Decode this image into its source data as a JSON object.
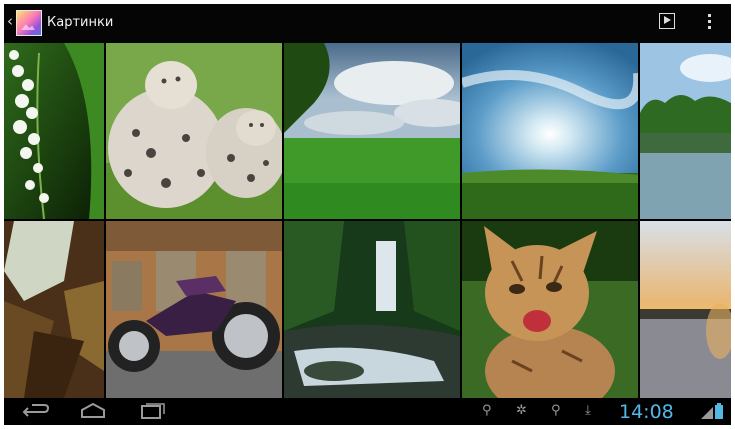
{
  "action_bar": {
    "title": "Картинки",
    "app_icon": "gallery-app-icon",
    "back_icon": "chevron-left-icon",
    "actions": [
      "slideshow-icon",
      "overflow-menu-icon"
    ]
  },
  "grid": {
    "photos": [
      {
        "subject": "lily-of-the-valley"
      },
      {
        "subject": "snow-leopards"
      },
      {
        "subject": "green-meadow-sky"
      },
      {
        "subject": "sunset-grass-field"
      },
      {
        "subject": "lake-trees-reflection"
      },
      {
        "subject": "autumn-leaves"
      },
      {
        "subject": "motorcycle"
      },
      {
        "subject": "forest-waterfall"
      },
      {
        "subject": "kitten"
      },
      {
        "subject": "lake-sunset"
      }
    ]
  },
  "nav_bar": {
    "buttons": [
      "back-icon",
      "home-icon",
      "recent-apps-icon"
    ],
    "status_icons": [
      "usb-icon",
      "android-debug-icon",
      "usb-icon",
      "download-icon",
      "signal-icon",
      "battery-icon"
    ],
    "clock": "14:08"
  },
  "colors": {
    "clock": "#54b7e5",
    "bar_background": "#000000",
    "icon": "#9a9a9a"
  }
}
